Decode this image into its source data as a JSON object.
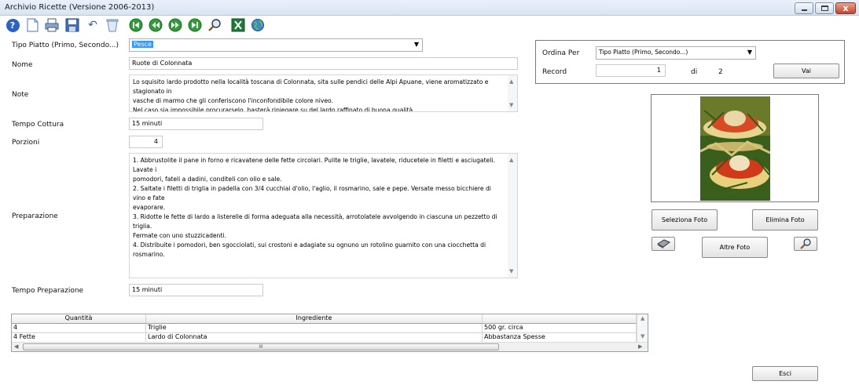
{
  "window": {
    "title": "Archivio Ricette (Versione 2006-2013)",
    "close_glyph": "x"
  },
  "toolbar": {
    "icons": [
      "help-icon",
      "new-document-icon",
      "print-icon",
      "save-icon",
      "undo-icon",
      "delete-bin-icon",
      "first-record-icon",
      "previous-record-icon",
      "next-record-icon",
      "last-record-icon",
      "search-icon",
      "excel-icon",
      "web-globe-icon"
    ],
    "help_glyph": "?",
    "undo_glyph": "↶"
  },
  "form": {
    "tipo_label": "Tipo Piatto (Primo, Secondo...)",
    "tipo_value": "Pesce",
    "nome_label": "Nome",
    "nome_value": "Ruote di Colonnata",
    "note_label": "Note",
    "note_lines": [
      "Lo squisito lardo prodotto nella località toscana di Colonnata, sita sulle pendici delle Alpi Apuane, viene aromatizzato e stagionato in",
      "vasche di marmo che gli conferiscono l'inconfondibile colore niveo.",
      "Nel caso sia impossibile procurarselo, basterà ripiegare su del lardo raffinato di buona qualità."
    ],
    "cottura_label": "Tempo Cottura",
    "cottura_value": "15 minuti",
    "porzioni_label": "Porzioni",
    "porzioni_value": "4",
    "preparazione_label": "Preparazione",
    "preparazione_lines": [
      "1. Abbrustolite il pane in forno e ricavatene delle fette circolari. Pulite le triglie, lavatele, riducetele in filetti e asciugateli. Lavate i",
      "pomodori, fateli a dadini, conditeli con olio e sale.",
      "2. Saltate i filetti di triglia in padella con 3/4 cucchiai d'olio, l'aglio, il rosmarino, sale e pepe. Versate messo bicchiere di vino e fate",
      "evaporare.",
      "3. Ridotte le fette di lardo a listerelle di forma adeguata alla necessità, arrotolatele avvolgendo in ciascuna un pezzetto di triglia.",
      "Fermate con uno stuzzicadenti.",
      "4. Distribuite i pomodori, ben sgocciolati, sui crostoni e adagiate su ognuno un rotolino guarnito con una ciocchetta di rosmarino."
    ],
    "tempo_prep_label": "Tempo Preparazione",
    "tempo_prep_value": "15 minuti"
  },
  "sort_panel": {
    "ordina_label": "Ordina Per",
    "ordina_value": "Tipo Piatto (Primo, Secondo...)",
    "record_label": "Record",
    "record_value": "1",
    "di_label": "di",
    "total": "2",
    "vai_button": "Vai"
  },
  "photo_panel": {
    "seleziona_button": "Seleziona Foto",
    "elimina_button": "Elimina Foto",
    "altre_button": "Altre Foto"
  },
  "ingredients": {
    "headers": [
      "Quantità",
      "Ingrediente",
      ""
    ],
    "rows": [
      [
        "4",
        "Triglie",
        "500 gr. circa"
      ],
      [
        "4 Fette",
        "Lardo di Colonnata",
        "Abbastanza Spesse"
      ]
    ],
    "scroll_grip": "III"
  },
  "esci_button": "Esci",
  "colors": {
    "toolbar_green": "#2f9e3a",
    "help_blue": "#2a63c4",
    "selection": "#3399ff"
  }
}
